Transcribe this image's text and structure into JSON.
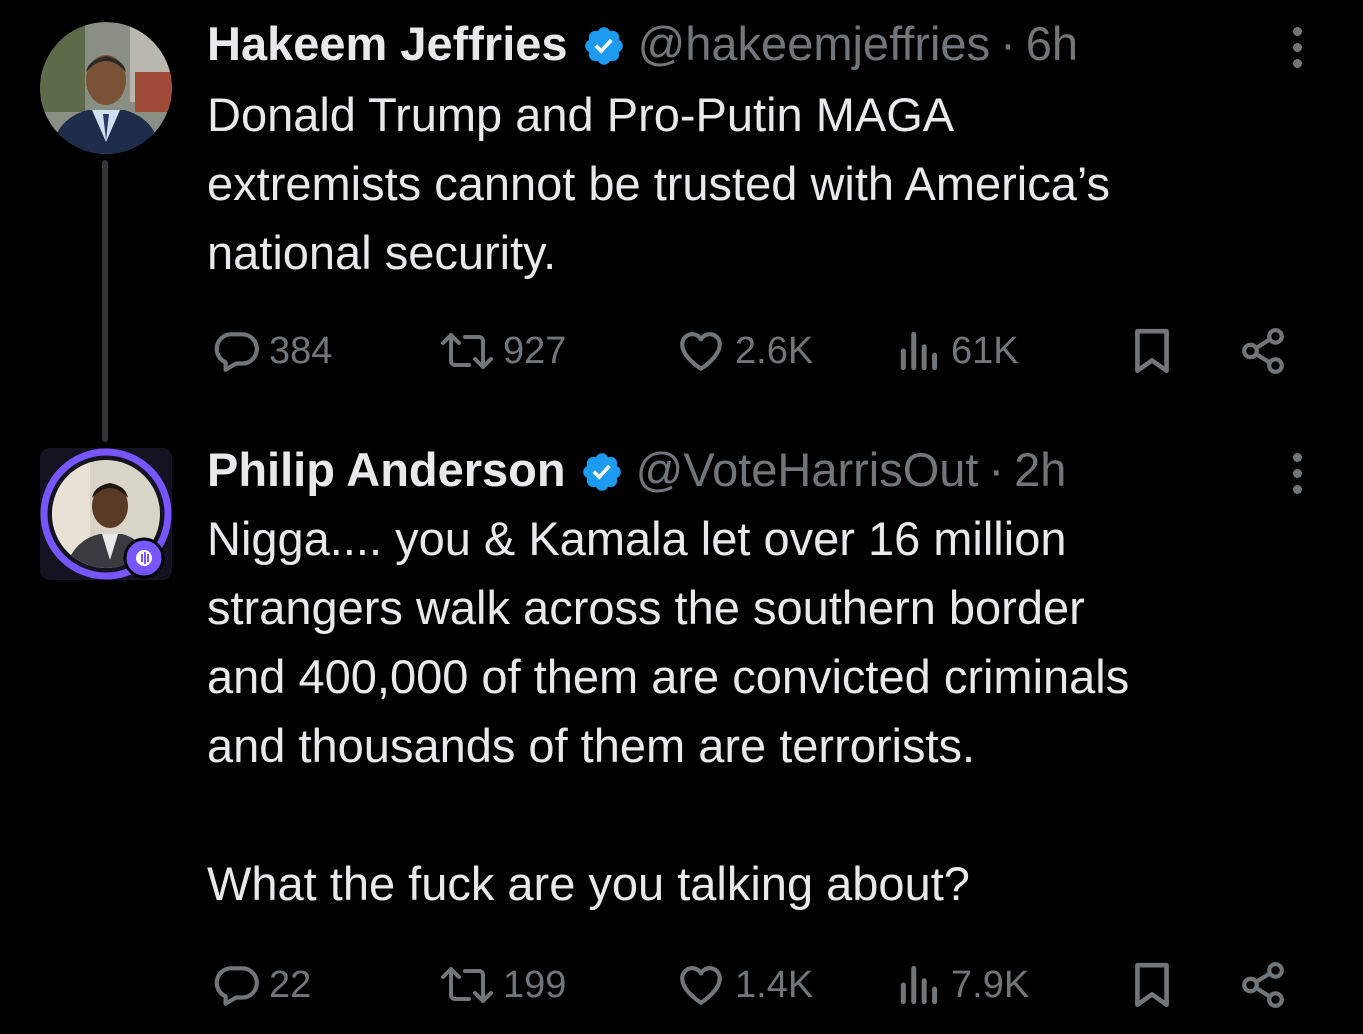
{
  "tweets": [
    {
      "name": "Hakeem Jeffries",
      "handle": "@hakeemjeffries",
      "dot": "·",
      "time": "6h",
      "text": "Donald Trump and Pro-Putin MAGA\nextremists cannot be trusted with America’s\nnational security.",
      "stats": {
        "replies": "384",
        "reposts": "927",
        "likes": "2.6K",
        "views": "61K"
      }
    },
    {
      "name": "Philip Anderson",
      "handle": "@VoteHarrisOut",
      "dot": "·",
      "time": "2h",
      "text": "Nigga.... you & Kamala let over 16 million\nstrangers walk across the southern border\nand 400,000 of them are convicted criminals\nand thousands of them are terrorists.\n\nWhat the fuck are you talking about?",
      "stats": {
        "replies": "22",
        "reposts": "199",
        "likes": "1.4K",
        "views": "7.9K"
      }
    }
  ],
  "icons": {
    "verified": "verified-badge-icon",
    "more": "more-options-icon",
    "reply": "reply-icon",
    "repost": "repost-icon",
    "like": "heart-icon",
    "views": "views-icon",
    "bookmark": "bookmark-icon",
    "share": "share-icon"
  },
  "colors": {
    "background": "#000000",
    "text": "#e7e9ea",
    "secondary": "#71767b",
    "verified": "#1d9bf0",
    "spaces_ring": "#7856ff"
  }
}
